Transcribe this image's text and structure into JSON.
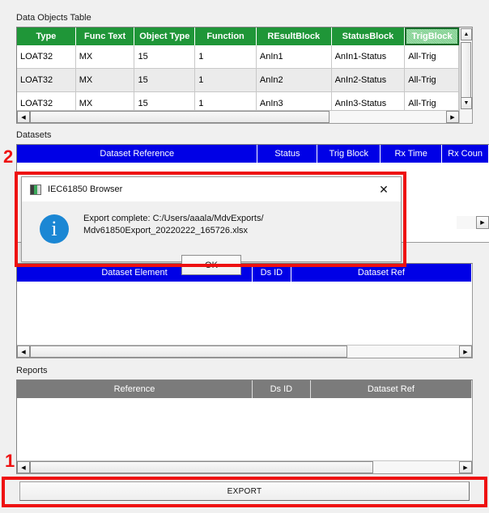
{
  "sections": {
    "data_objects_label": "Data Objects Table",
    "datasets_label": "Datasets",
    "reports_label": "Reports"
  },
  "data_objects_table": {
    "columns": [
      "Type",
      "Func Text",
      "Object Type",
      "Function",
      "REsultBlock",
      "StatusBlock",
      "TrigBlock"
    ],
    "selected_column": "TrigBlock",
    "rows": [
      [
        "LOAT32",
        "MX",
        "15",
        "1",
        "AnIn1",
        "AnIn1-Status",
        "All-Trig"
      ],
      [
        "LOAT32",
        "MX",
        "15",
        "1",
        "AnIn2",
        "AnIn2-Status",
        "All-Trig"
      ],
      [
        "LOAT32",
        "MX",
        "15",
        "1",
        "AnIn3",
        "AnIn3-Status",
        "All-Trig"
      ]
    ]
  },
  "datasets_table": {
    "columns": [
      "Dataset Reference",
      "Status",
      "Trig Block",
      "Rx Time",
      "Rx Coun"
    ],
    "rows": []
  },
  "dataset_elements_table": {
    "columns": [
      "Dataset Element",
      "Ds ID",
      "Dataset Ref"
    ],
    "rows": []
  },
  "reports_table": {
    "columns": [
      "Reference",
      "Ds ID",
      "Dataset Ref"
    ],
    "rows": []
  },
  "export_button": {
    "label": "EXPORT"
  },
  "dialog": {
    "title": "IEC61850 Browser",
    "icon": "app-icon",
    "close_glyph": "✕",
    "info_glyph": "i",
    "message_line1": "Export complete: C:/Users/aaala/MdvExports/",
    "message_line2": "Mdv61850Export_20220222_165726.xlsx",
    "ok_label": "OK"
  },
  "annotations": {
    "marker_1": "1",
    "marker_2": "2"
  },
  "scrollbars": {
    "left_arrow": "◀",
    "right_arrow": "▶",
    "up_arrow": "▲",
    "down_arrow": "▼"
  },
  "colors": {
    "header_green": "#1f9638",
    "header_green_selected": "#7fd08f",
    "header_blue": "#0000e6",
    "header_grey": "#7b7b7b",
    "annotation_red": "#ee1111",
    "info_blue": "#1b87d4",
    "window_bg": "#f0f0f0"
  }
}
